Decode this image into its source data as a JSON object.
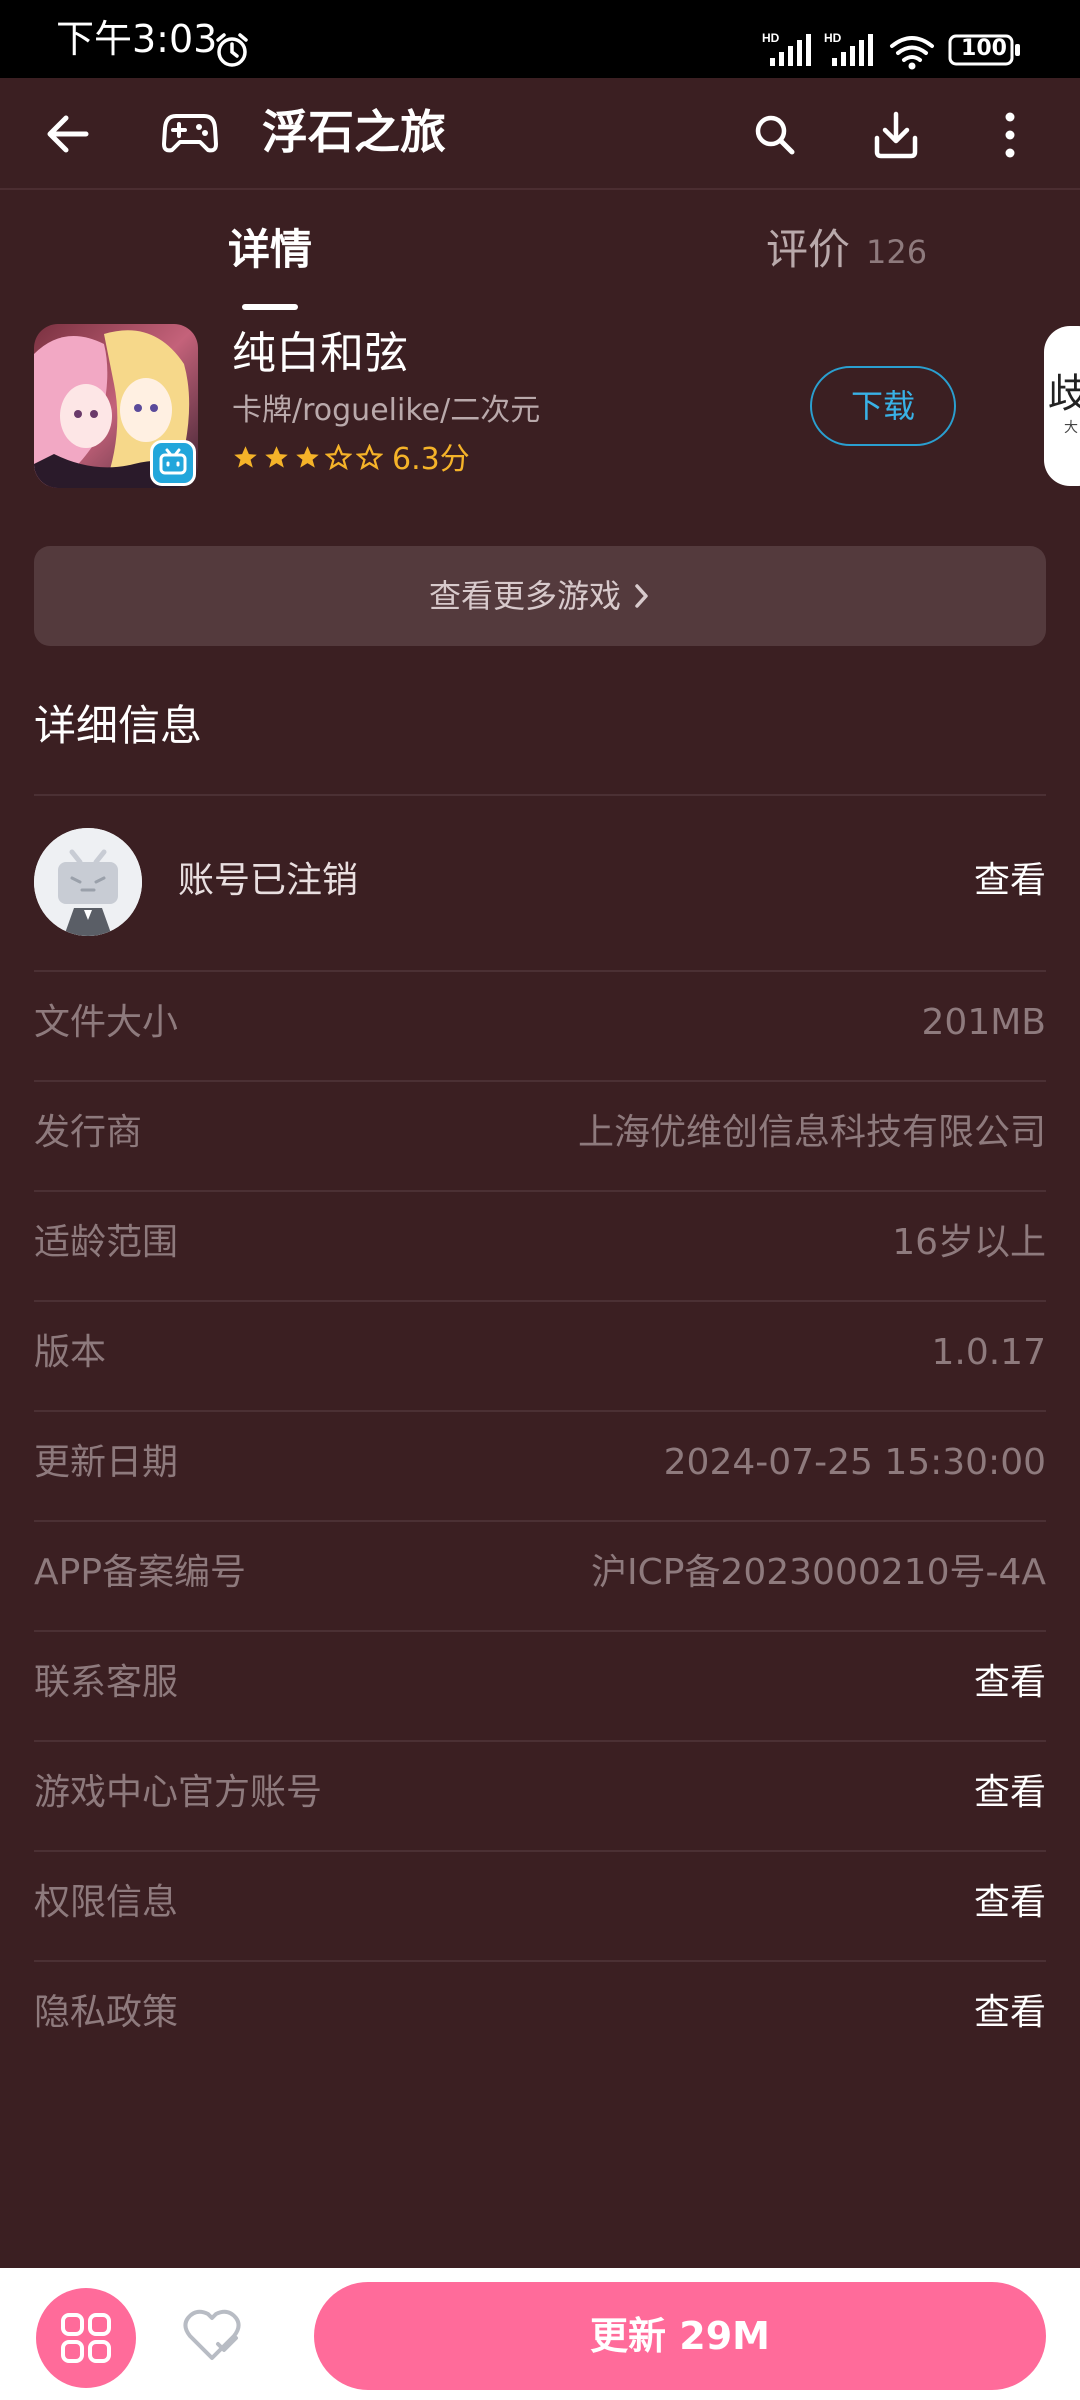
{
  "status_bar": {
    "time": "下午3:03",
    "battery": "100",
    "network_label": "HD"
  },
  "header": {
    "title": "浮石之旅",
    "icons": [
      "back-arrow-icon",
      "gamepad-icon",
      "search-icon",
      "download-icon",
      "more-vertical-icon"
    ]
  },
  "tabs": [
    {
      "label": "详情",
      "active": true
    },
    {
      "label": "评价",
      "count": "126",
      "active": false
    }
  ],
  "game": {
    "name": "纯白和弦",
    "tags": "卡牌/roguelike/二次元",
    "rating": 3,
    "rating_max": 5,
    "rating_text": "6.3分",
    "download_label": "下载"
  },
  "next_card": {
    "char": "歧",
    "sub": "大"
  },
  "more_games_label": "查看更多游戏",
  "details": {
    "title": "详细信息",
    "developer_name": "账号已注销",
    "developer_action": "查看",
    "rows": [
      {
        "label": "文件大小",
        "value": "201MB",
        "link": false
      },
      {
        "label": "发行商",
        "value": "上海优维创信息科技有限公司",
        "link": false
      },
      {
        "label": "适龄范围",
        "value": "16岁以上",
        "link": false
      },
      {
        "label": "版本",
        "value": "1.0.17",
        "link": false
      },
      {
        "label": "更新日期",
        "value": "2024-07-25 15:30:00",
        "link": false
      },
      {
        "label": "APP备案编号",
        "value": "沪ICP备2023000210号-4A",
        "link": false
      },
      {
        "label": "联系客服",
        "value": "查看",
        "link": true
      },
      {
        "label": "游戏中心官方账号",
        "value": "查看",
        "link": true
      },
      {
        "label": "权限信息",
        "value": "查看",
        "link": true
      },
      {
        "label": "隐私政策",
        "value": "查看",
        "link": true
      }
    ]
  },
  "bottom_bar": {
    "update_label": "更新 29M"
  },
  "colors": {
    "background": "#3b1f22",
    "accent_pink": "#ff6b9a",
    "link_blue": "#39b1e6",
    "rating_gold": "#f5b329"
  }
}
